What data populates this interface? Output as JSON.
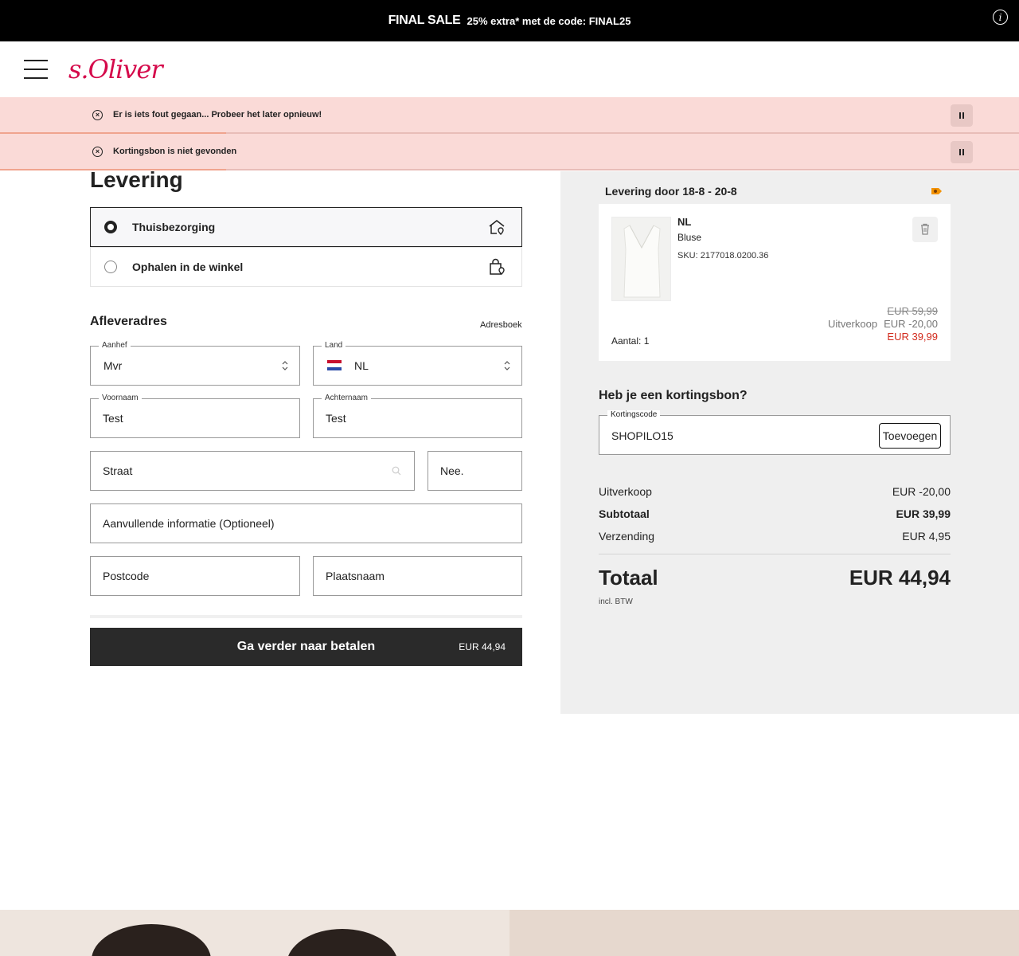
{
  "promo": {
    "headline": "FINAL SALE",
    "text": "25% extra* met de code: FINAL25",
    "info_icon": "info-icon"
  },
  "brand": {
    "logo": "s.Oliver",
    "color": "#d50a4b"
  },
  "toasts": [
    {
      "message": "Er is iets fout gegaan... Probeer het later opnieuw!"
    },
    {
      "message": "Kortingsbon is niet gevonden"
    }
  ],
  "delivery": {
    "title": "Levering",
    "options": [
      {
        "label": "Thuisbezorging",
        "selected": true,
        "icon": "home-pin-icon"
      },
      {
        "label": "Ophalen in de winkel",
        "selected": false,
        "icon": "store-bag-icon"
      }
    ]
  },
  "address": {
    "title": "Afleveradres",
    "address_book": "Adresboek",
    "salutation": {
      "label": "Aanhef",
      "value": "Mvr"
    },
    "country": {
      "label": "Land",
      "value": "NL"
    },
    "first_name": {
      "label": "Voornaam",
      "value": "Test"
    },
    "last_name": {
      "label": "Achternaam",
      "value": "Test"
    },
    "street": {
      "placeholder": "Straat"
    },
    "number": {
      "placeholder": "Nee."
    },
    "additional": {
      "placeholder": "Aanvullende informatie (Optioneel)"
    },
    "postcode": {
      "placeholder": "Postcode"
    },
    "city": {
      "placeholder": "Plaatsnaam"
    }
  },
  "cta": {
    "label": "Ga verder naar betalen",
    "price": "EUR 44,94"
  },
  "summary": {
    "delivery_window": "Levering door 18-8 - 20-8",
    "product": {
      "name": "NL",
      "type": "Bluse",
      "sku": "SKU: 2177018.0200.36",
      "old_price": "EUR 59,99",
      "discount_label": "Uitverkoop",
      "discount": "EUR -20,00",
      "new_price": "EUR 39,99",
      "quantity": "Aantal: 1"
    },
    "coupon": {
      "title": "Heb je een kortingsbon?",
      "label": "Kortingscode",
      "value": "SHOPILO15",
      "button": "Toevoegen"
    },
    "lines": [
      {
        "label": "Uitverkoop",
        "value": "EUR -20,00"
      },
      {
        "label": "Subtotaal",
        "value": "EUR 39,99"
      },
      {
        "label": "Verzending",
        "value": "EUR 4,95"
      }
    ],
    "total_label": "Totaal",
    "total_value": "EUR 44,94",
    "vat_note": "incl. BTW"
  }
}
